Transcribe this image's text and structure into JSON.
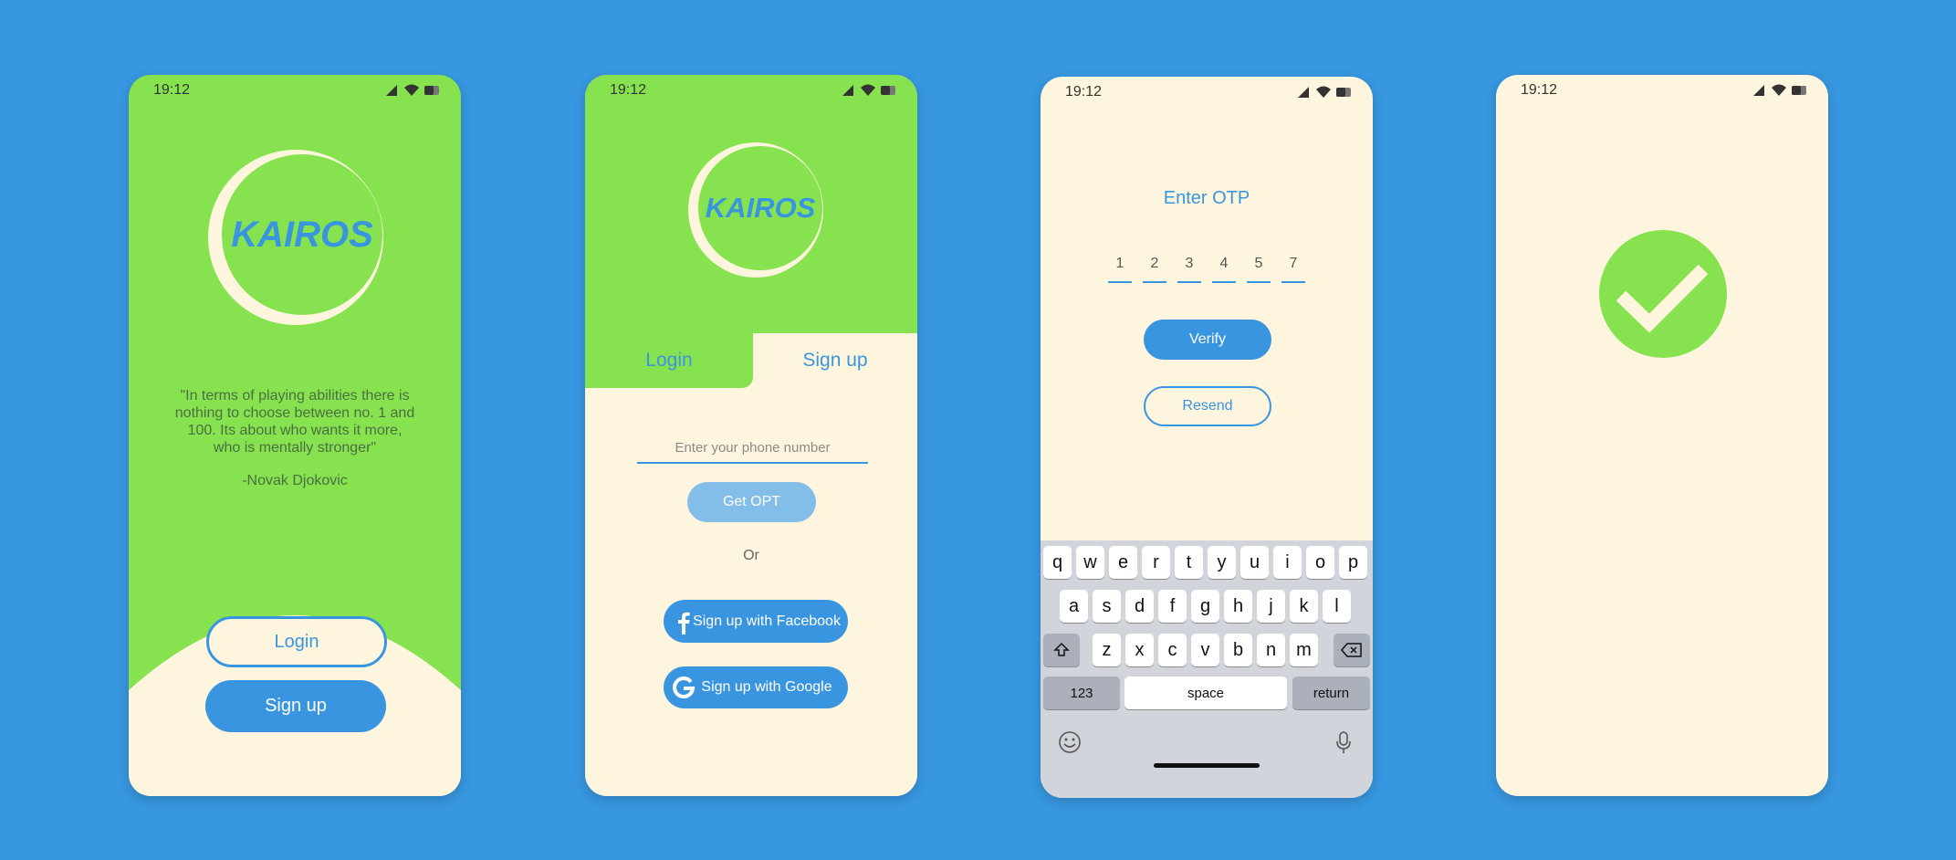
{
  "colors": {
    "background": "#3797e0",
    "green": "#86e24e",
    "cream": "#fdf5dd",
    "blue": "#3a95e0",
    "light_blue": "#82bee8",
    "keyboard": "#d1d4db"
  },
  "status_bar": {
    "time": "19:12",
    "icons": [
      "signal-icon",
      "wifi-icon",
      "battery-icon"
    ]
  },
  "welcome": {
    "logo_text": "KAIROS",
    "quote": "\"In terms of playing abilities there is nothing to choose between no. 1 and 100. Its about who wants it more, who is mentally stronger\"",
    "author": "-Novak Djokovic",
    "login_label": "Login",
    "signup_label": "Sign up"
  },
  "signup": {
    "logo_text": "KAIROS",
    "tab_login": "Login",
    "tab_signup": "Sign up",
    "phone_placeholder": "Enter your phone number",
    "get_otp_label": "Get OPT",
    "or_label": "Or",
    "facebook_label": "Sign up with Facebook",
    "google_label": "Sign up with Google"
  },
  "otp": {
    "title": "Enter OTP",
    "digits": [
      "1",
      "2",
      "3",
      "4",
      "5",
      "7"
    ],
    "verify_label": "Verify",
    "resend_label": "Resend"
  },
  "keyboard": {
    "row1": [
      "q",
      "w",
      "e",
      "r",
      "t",
      "y",
      "u",
      "i",
      "o",
      "p"
    ],
    "row2": [
      "a",
      "s",
      "d",
      "f",
      "g",
      "h",
      "j",
      "k",
      "l"
    ],
    "row3": [
      "z",
      "x",
      "c",
      "v",
      "b",
      "n",
      "m"
    ],
    "numbers_key": "123",
    "space_key": "space",
    "return_key": "return"
  },
  "success": {
    "icon": "checkmark-icon"
  }
}
